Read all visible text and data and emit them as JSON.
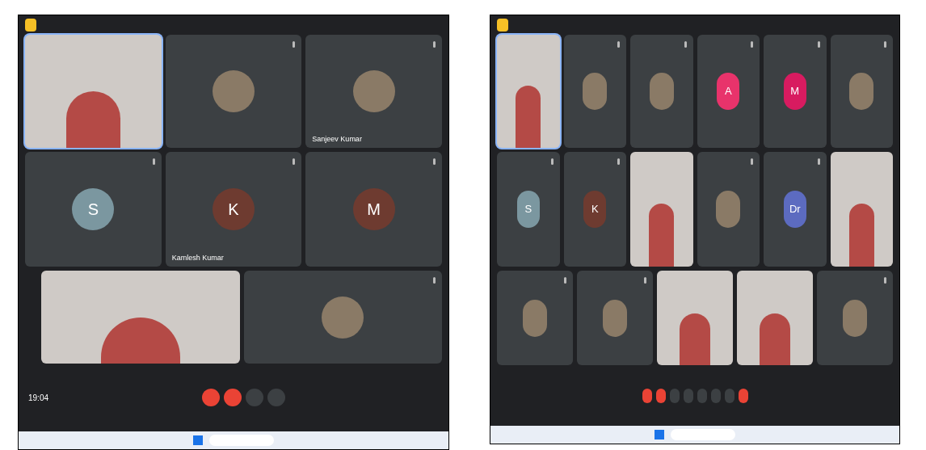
{
  "screens": [
    {
      "tile_rows": [
        [
          {
            "kind": "video",
            "speaking": true
          },
          {
            "kind": "photo"
          },
          {
            "kind": "photo",
            "name": "Sanjeev Kumar"
          }
        ],
        [
          {
            "kind": "letter",
            "letter": "S",
            "color": "#7b97a0"
          },
          {
            "kind": "letter",
            "letter": "K",
            "name": "Kamlesh Kumar",
            "color": "#6e3b30"
          },
          {
            "kind": "letter",
            "letter": "M",
            "color": "#6e3b30"
          }
        ],
        [
          {
            "kind": "video"
          },
          {
            "kind": "photo"
          }
        ]
      ],
      "clock": "19:04",
      "controls": [
        {
          "kind": "danger"
        },
        {
          "kind": "danger"
        },
        {
          "kind": "plain"
        },
        {
          "kind": "plain"
        }
      ]
    },
    {
      "tile_rows": [
        [
          {
            "kind": "video",
            "speaking": true
          },
          {
            "kind": "photo"
          },
          {
            "kind": "photo"
          },
          {
            "kind": "letter",
            "letter": "A",
            "color": "#e8336b"
          },
          {
            "kind": "letter",
            "letter": "M",
            "color": "#d81b60"
          },
          {
            "kind": "photo"
          }
        ],
        [
          {
            "kind": "letter",
            "letter": "S",
            "color": "#7b97a0"
          },
          {
            "kind": "letter",
            "letter": "K",
            "color": "#6e3b30"
          },
          {
            "kind": "video"
          },
          {
            "kind": "photo"
          },
          {
            "kind": "letter",
            "letter": "Dr",
            "color": "#5c6bc0"
          },
          {
            "kind": "video"
          }
        ],
        [
          {
            "kind": "photo"
          },
          {
            "kind": "photo"
          },
          {
            "kind": "video"
          },
          {
            "kind": "video"
          },
          {
            "kind": "photo"
          }
        ]
      ],
      "controls": [
        {
          "kind": "danger"
        },
        {
          "kind": "danger"
        },
        {
          "kind": "plain"
        },
        {
          "kind": "plain"
        },
        {
          "kind": "plain"
        },
        {
          "kind": "plain"
        },
        {
          "kind": "plain"
        },
        {
          "kind": "danger"
        }
      ]
    }
  ]
}
